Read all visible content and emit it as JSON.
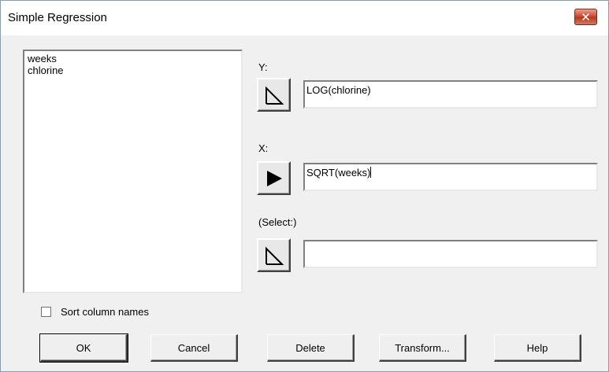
{
  "window": {
    "title": "Simple Regression",
    "close_glyph": "✕"
  },
  "variables": [
    "weeks",
    "chlorine"
  ],
  "fields": {
    "y": {
      "label": "Y:",
      "value": "LOG(chlorine)",
      "button_icon": "outline-arrow-icon"
    },
    "x": {
      "label": "X:",
      "value": "SQRT(weeks)",
      "button_icon": "filled-arrow-icon"
    },
    "select": {
      "label": "(Select:)",
      "value": "",
      "button_icon": "outline-arrow-icon"
    }
  },
  "sort_checkbox": {
    "label": "Sort column names",
    "checked": false
  },
  "buttons": {
    "ok": "OK",
    "cancel": "Cancel",
    "delete": "Delete",
    "transform": "Transform...",
    "help": "Help"
  },
  "colors": {
    "dialog_bg": "#f0f0f0",
    "close_button": "#c8482f"
  }
}
